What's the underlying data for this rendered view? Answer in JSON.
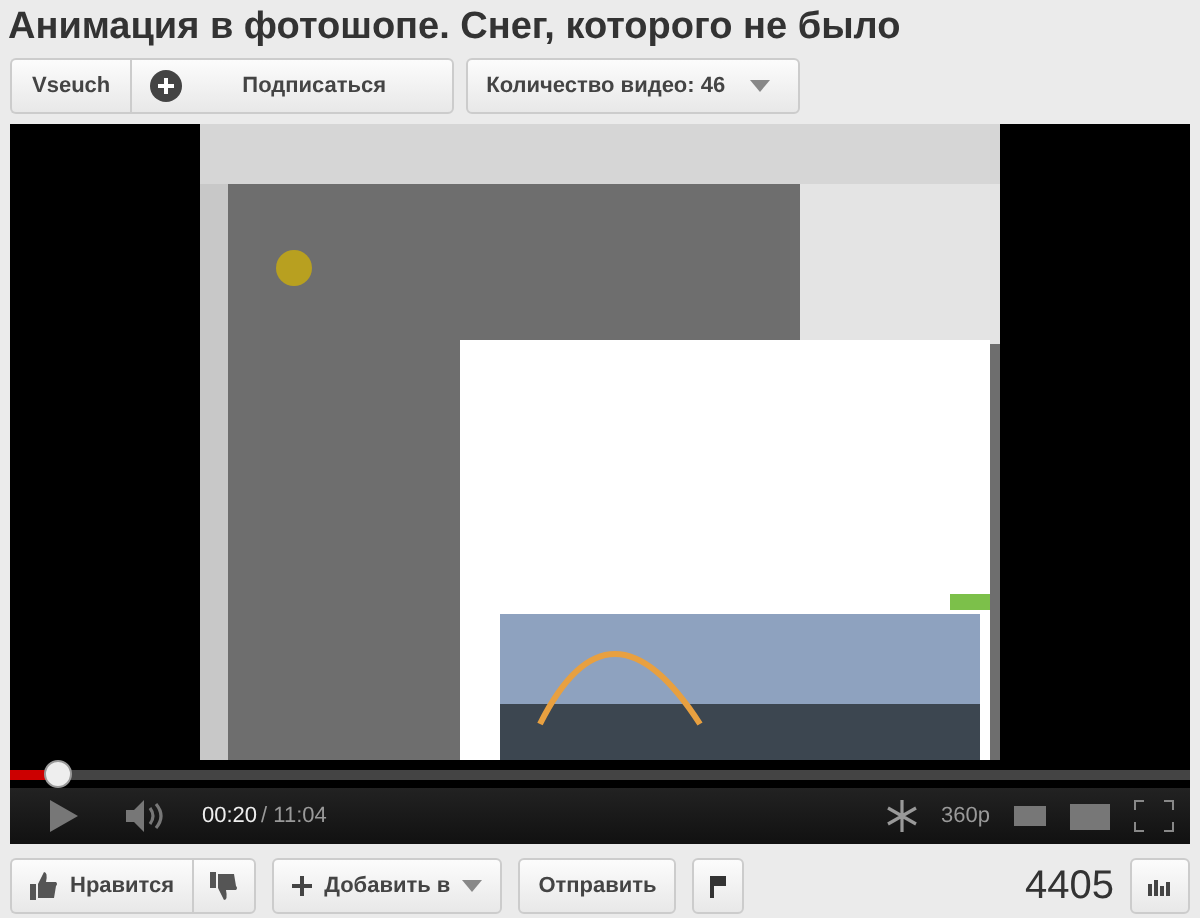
{
  "title": "Анимация в фотошопе. Снег, которого не было",
  "channel": {
    "name": "Vseuch",
    "subscribe": "Подписаться",
    "video_count": "Количество видео: 46"
  },
  "player": {
    "progress": {
      "level": 0.04
    },
    "current_time": "00:20",
    "duration": "/ 11:04",
    "quality": "360p"
  },
  "actions": {
    "like": "Нравится",
    "add": "Добавить в",
    "share": "Отправить"
  },
  "views": "4405"
}
